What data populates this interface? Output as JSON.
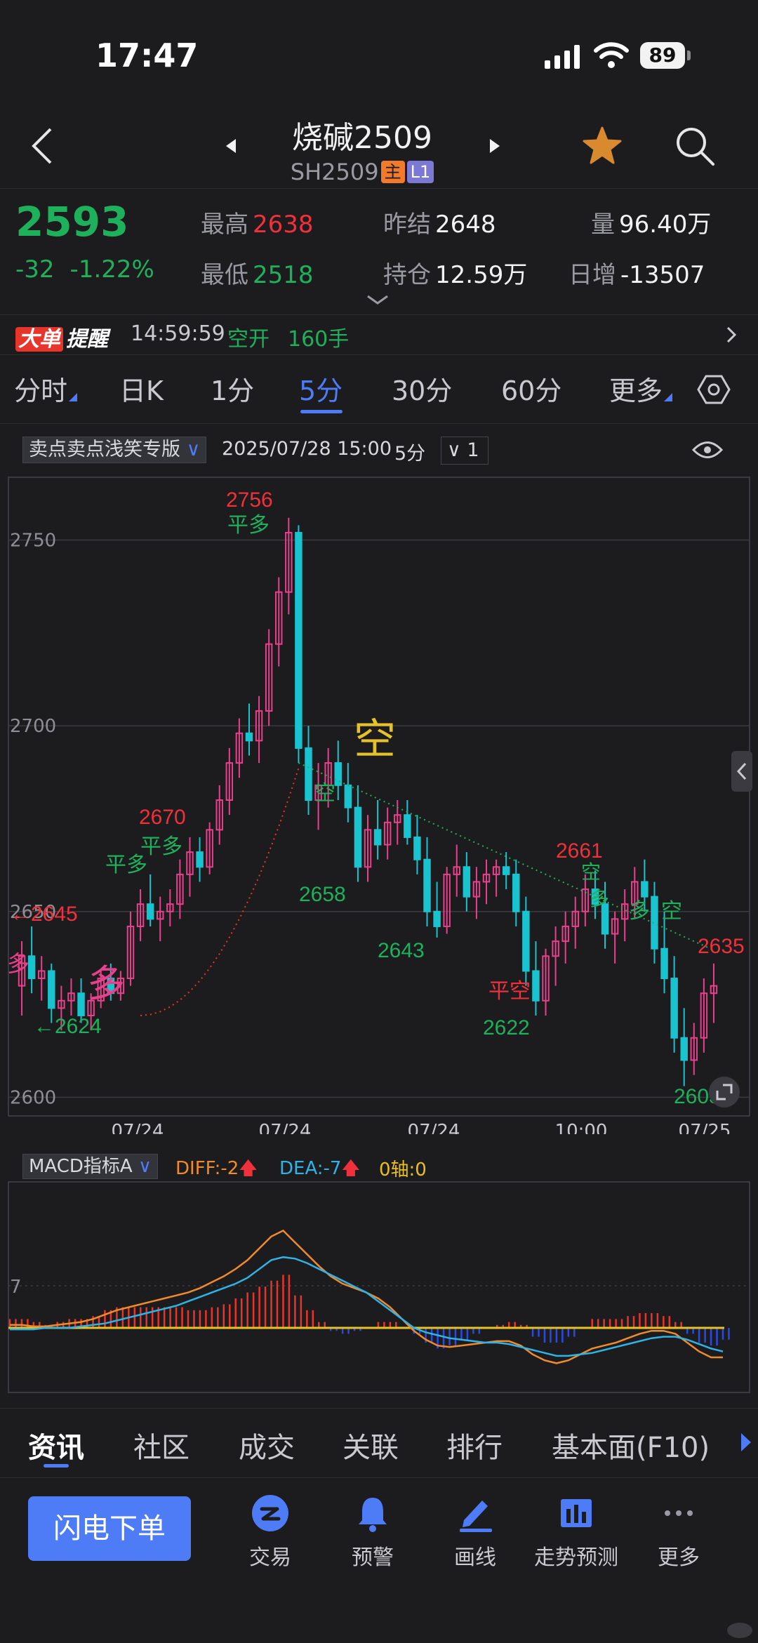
{
  "status_bar": {
    "time": "17:47",
    "battery": "89"
  },
  "header": {
    "title": "烧碱2509",
    "code": "SH2509",
    "tag_main": "主",
    "tag_level": "L1"
  },
  "quote": {
    "price": "2593",
    "change": "-32",
    "change_pct": "-1.22%",
    "high_label": "最高",
    "high": "2638",
    "low_label": "最低",
    "low": "2518",
    "prev_settle_label": "昨结",
    "prev_settle": "2648",
    "open_interest_label": "持仓",
    "open_interest": "12.59万",
    "volume_label": "量",
    "volume": "96.40万",
    "daily_change_label": "日增",
    "daily_change": "-13507"
  },
  "alert": {
    "badge_1": "大单",
    "badge_2": "提醒",
    "time": "14:59:59",
    "action": "空开",
    "qty": "160手"
  },
  "period_tabs": [
    "分时",
    "日K",
    "1分",
    "5分",
    "30分",
    "60分",
    "更多"
  ],
  "active_period_index": 3,
  "chart_toolbar": {
    "indicator": "卖点卖点浅笑专版",
    "datetime": "2025/07/28 15:00",
    "period": "5分",
    "ma_value": "1"
  },
  "chart_data": {
    "type": "candlestick",
    "y_ticks": [
      2750,
      2700,
      2650,
      2600
    ],
    "ylim": [
      2598,
      2762
    ],
    "x_labels": [
      "07/24",
      "07/24",
      "07/24",
      "10:00",
      "07/25"
    ],
    "candles": [
      [
        2630,
        2642,
        2622,
        2638
      ],
      [
        2638,
        2646,
        2628,
        2632
      ],
      [
        2632,
        2638,
        2626,
        2634
      ],
      [
        2634,
        2636,
        2620,
        2624
      ],
      [
        2624,
        2630,
        2618,
        2626
      ],
      [
        2626,
        2632,
        2622,
        2628
      ],
      [
        2628,
        2632,
        2620,
        2622
      ],
      [
        2622,
        2628,
        2618,
        2626
      ],
      [
        2626,
        2634,
        2624,
        2632
      ],
      [
        2632,
        2636,
        2626,
        2628
      ],
      [
        2628,
        2634,
        2626,
        2632
      ],
      [
        2632,
        2650,
        2630,
        2646
      ],
      [
        2646,
        2656,
        2642,
        2652
      ],
      [
        2652,
        2660,
        2646,
        2648
      ],
      [
        2648,
        2654,
        2642,
        2650
      ],
      [
        2650,
        2656,
        2646,
        2652
      ],
      [
        2652,
        2664,
        2648,
        2660
      ],
      [
        2660,
        2670,
        2654,
        2666
      ],
      [
        2666,
        2670,
        2658,
        2662
      ],
      [
        2662,
        2674,
        2660,
        2672
      ],
      [
        2672,
        2684,
        2668,
        2680
      ],
      [
        2680,
        2694,
        2676,
        2690
      ],
      [
        2690,
        2702,
        2686,
        2698
      ],
      [
        2698,
        2706,
        2692,
        2696
      ],
      [
        2696,
        2708,
        2690,
        2704
      ],
      [
        2704,
        2726,
        2700,
        2722
      ],
      [
        2722,
        2740,
        2716,
        2736
      ],
      [
        2736,
        2756,
        2730,
        2752
      ],
      [
        2752,
        2754,
        2690,
        2694
      ],
      [
        2694,
        2700,
        2676,
        2680
      ],
      [
        2680,
        2690,
        2672,
        2684
      ],
      [
        2684,
        2694,
        2678,
        2690
      ],
      [
        2690,
        2696,
        2680,
        2684
      ],
      [
        2684,
        2690,
        2674,
        2678
      ],
      [
        2678,
        2684,
        2658,
        2662
      ],
      [
        2662,
        2676,
        2658,
        2672
      ],
      [
        2672,
        2680,
        2664,
        2668
      ],
      [
        2668,
        2678,
        2664,
        2674
      ],
      [
        2674,
        2680,
        2668,
        2676
      ],
      [
        2676,
        2680,
        2668,
        2670
      ],
      [
        2670,
        2676,
        2660,
        2664
      ],
      [
        2664,
        2670,
        2646,
        2650
      ],
      [
        2650,
        2658,
        2643,
        2646
      ],
      [
        2646,
        2662,
        2644,
        2660
      ],
      [
        2660,
        2668,
        2654,
        2662
      ],
      [
        2662,
        2666,
        2650,
        2654
      ],
      [
        2654,
        2662,
        2648,
        2658
      ],
      [
        2658,
        2664,
        2652,
        2660
      ],
      [
        2660,
        2664,
        2654,
        2662
      ],
      [
        2662,
        2666,
        2656,
        2660
      ],
      [
        2660,
        2664,
        2646,
        2650
      ],
      [
        2650,
        2654,
        2630,
        2634
      ],
      [
        2634,
        2642,
        2622,
        2626
      ],
      [
        2626,
        2640,
        2622,
        2638
      ],
      [
        2638,
        2646,
        2630,
        2642
      ],
      [
        2642,
        2650,
        2636,
        2646
      ],
      [
        2646,
        2654,
        2640,
        2650
      ],
      [
        2650,
        2660,
        2646,
        2656
      ],
      [
        2656,
        2661,
        2648,
        2652
      ],
      [
        2652,
        2658,
        2640,
        2644
      ],
      [
        2644,
        2650,
        2636,
        2648
      ],
      [
        2648,
        2656,
        2642,
        2652
      ],
      [
        2652,
        2662,
        2648,
        2658
      ],
      [
        2658,
        2664,
        2650,
        2654
      ],
      [
        2654,
        2658,
        2636,
        2640
      ],
      [
        2640,
        2650,
        2628,
        2632
      ],
      [
        2632,
        2638,
        2612,
        2616
      ],
      [
        2616,
        2624,
        2603,
        2610
      ],
      [
        2610,
        2620,
        2606,
        2616
      ],
      [
        2616,
        2632,
        2612,
        2628
      ],
      [
        2628,
        2636,
        2620,
        2630
      ]
    ],
    "annotations": {
      "top_price": "2756",
      "top_signal": "平多",
      "short_signal": "空",
      "p2670": "2670",
      "p2645": "←2645",
      "p2624": "←2624",
      "p2658": "2658",
      "p2643": "2643",
      "p2622": "2622",
      "p2661": "2661",
      "p2635": "2635",
      "p2603": "2603",
      "sig_pingduo_1": "平多",
      "sig_pingduo_2": "平多",
      "sig_duo_big": "多",
      "sig_duo_left": "多",
      "sig_kong_1": "空",
      "sig_pingkong": "平空",
      "sig_kong_2": "空",
      "sig_duo_2": "多",
      "sig_duo_3": "多",
      "sig_kong_3": "空"
    },
    "colors": {
      "up": "#e8408c",
      "down": "#19c3cf",
      "signal_up": "#f0313c",
      "signal_down": "#1eb05a",
      "highlight": "#e6e22a"
    }
  },
  "macd": {
    "label": "MACD指标A",
    "diff": "DIFF:-2",
    "dea": "DEA:-7",
    "zero": "0轴:0",
    "tick": "7",
    "diff_series": [
      2,
      2,
      1,
      1,
      2,
      3,
      4,
      6,
      9,
      12,
      14,
      16,
      18,
      20,
      22,
      24,
      27,
      31,
      35,
      40,
      46,
      54,
      62,
      66,
      58,
      50,
      42,
      35,
      30,
      27,
      24,
      20,
      14,
      6,
      -2,
      -8,
      -12,
      -13,
      -12,
      -11,
      -10,
      -9,
      -9,
      -12,
      -18,
      -22,
      -24,
      -22,
      -18,
      -14,
      -12,
      -10,
      -7,
      -4,
      -2,
      -2,
      -4,
      -10,
      -16,
      -20,
      -20
    ],
    "dea_series": [
      -1,
      -1,
      -1,
      0,
      0,
      0,
      1,
      2,
      3,
      5,
      7,
      9,
      11,
      13,
      15,
      18,
      21,
      24,
      27,
      30,
      34,
      40,
      46,
      48,
      47,
      44,
      40,
      36,
      32,
      28,
      24,
      18,
      12,
      6,
      0,
      -3,
      -5,
      -7,
      -8,
      -9,
      -10,
      -10,
      -11,
      -13,
      -15,
      -17,
      -19,
      -19,
      -18,
      -17,
      -15,
      -13,
      -11,
      -9,
      -7,
      -6,
      -6,
      -8,
      -11,
      -14,
      -16
    ]
  },
  "info_tabs": [
    "资讯",
    "社区",
    "成交",
    "关联",
    "排行",
    "基本面(F10)"
  ],
  "bottom_nav": {
    "order_button": "闪电下单",
    "items": [
      "交易",
      "预警",
      "画线",
      "走势预测",
      "更多"
    ]
  }
}
